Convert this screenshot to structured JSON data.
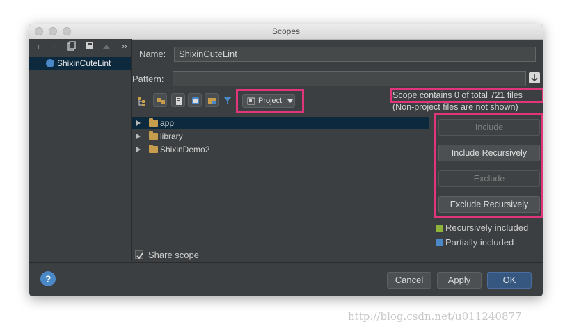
{
  "window": {
    "title": "Scopes"
  },
  "left_toolbar": {
    "add": "+",
    "remove": "−",
    "more": "››"
  },
  "scopes": [
    {
      "label": "ShixinCuteLint"
    }
  ],
  "form": {
    "name_label": "Name:",
    "name_value": "ShixinCuteLint",
    "pattern_label": "Pattern:",
    "pattern_value": ""
  },
  "toolbar": {
    "project_dropdown": "Project"
  },
  "scope_info": {
    "line1": "Scope contains 0 of total 721 files",
    "line2": "(Non-project files are not shown)"
  },
  "tree": [
    {
      "label": "app"
    },
    {
      "label": "library"
    },
    {
      "label": "ShixinDemo2"
    }
  ],
  "actions": {
    "include": "Include",
    "include_recursively": "Include Recursively",
    "exclude": "Exclude",
    "exclude_recursively": "Exclude Recursively"
  },
  "legend": [
    {
      "label": "Recursively included",
      "color": "#8db33a"
    },
    {
      "label": "Partially included",
      "color": "#4a88c7"
    }
  ],
  "share_scope": {
    "label": "Share scope",
    "checked": true
  },
  "footer": {
    "help": "?",
    "cancel": "Cancel",
    "apply": "Apply",
    "ok": "OK"
  },
  "colors": {
    "highlight": "#e0357a",
    "selection": "#0d293e",
    "panel": "#3c3f41"
  },
  "watermark": "http://blog.csdn.net/u011240877"
}
